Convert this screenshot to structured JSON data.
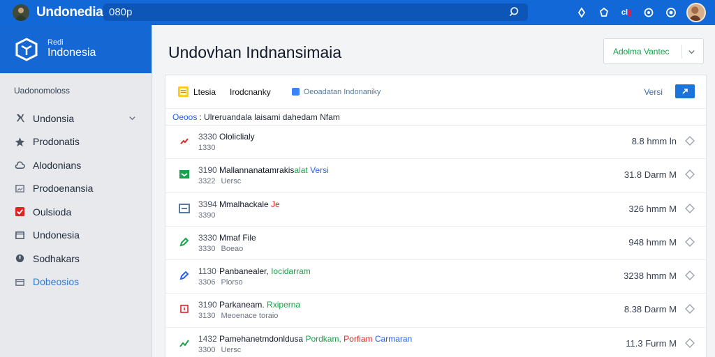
{
  "header": {
    "app_title": "Undonedia",
    "search_value": "080p",
    "icons": [
      "pin-icon",
      "tag-icon",
      "cl-badge-icon",
      "record-icon",
      "target-icon"
    ],
    "badge_text": "cl"
  },
  "sidebar": {
    "brand_sub": "Redi",
    "brand_name": "Indonesia",
    "section": "Uadonomoloss",
    "items": [
      {
        "label": "Undonsia",
        "icon": "wrench-icon",
        "has_chevron": true
      },
      {
        "label": "Prodonatis",
        "icon": "star-icon"
      },
      {
        "label": "Alodonians",
        "icon": "cloud-icon"
      },
      {
        "label": "Prodoenansia",
        "icon": "image-icon"
      },
      {
        "label": "Oulsioda",
        "icon": "check-icon"
      },
      {
        "label": "Undonesia",
        "icon": "folder-icon"
      },
      {
        "label": "Sodhakars",
        "icon": "circle-icon"
      },
      {
        "label": "Dobeosios",
        "icon": "card-icon",
        "active": true
      }
    ]
  },
  "main": {
    "title": "Undovhan Indnansimaia",
    "select_label": "Adolma Vantec",
    "panel": {
      "tab1": "Ltesia",
      "tab2": "Irodcnanky",
      "meta": "Oeoadatan Indonaniky",
      "versi": "Versi"
    },
    "filter": {
      "key": "Oeoos",
      "text": ": Ulreruandala laisami dahedam  Nfam"
    },
    "rows": [
      {
        "num": "3330",
        "name": "Ololiclialy",
        "tag": "",
        "tag2": "",
        "sub": "1330",
        "sub_text": "",
        "size": "8.8 hmm ln",
        "icon": "pen-icon",
        "color": "#dc2626"
      },
      {
        "num": "3190",
        "name": "Mallannanatamrakis",
        "tag": "alat",
        "tag2": "Versi",
        "sub": "3322",
        "sub_text": "Uersc",
        "size": "31.8 Darm M",
        "icon": "inbox-icon",
        "color": "#16a34a"
      },
      {
        "num": "3394",
        "name": "Mmalhackale",
        "tag": "",
        "tag2": "",
        "tag3": "Je",
        "sub": "3390",
        "sub_text": "",
        "size": "326 hmm M",
        "icon": "window-icon",
        "color": "#5b7a9a"
      },
      {
        "num": "3330",
        "name": "Mmaf File",
        "tag": "",
        "tag2": "",
        "sub": "3330",
        "sub_text": "Boeao",
        "size": "948 hmm M",
        "icon": "pencil-icon",
        "color": "#16a34a"
      },
      {
        "num": "1130",
        "name": "Panbanealer,",
        "tag": "Iocidarram",
        "tag2": "",
        "sub": "3306",
        "sub_text": "Plorso",
        "size": "3238 hmm M",
        "icon": "edit-icon",
        "color": "#2563eb"
      },
      {
        "num": "3190",
        "name": "Parkaneam.",
        "tag": "Rxiperna",
        "tag2": "",
        "sub": "3130",
        "sub_text": "Meoenace toraio",
        "size": "8.38 Darm M",
        "icon": "box-icon",
        "color": "#dc2626"
      },
      {
        "num": "1432",
        "name": "Pamehanetmdonldusa",
        "tag": "Pordkam,",
        "tag2": "Carmaran",
        "tag3": "Porfiam",
        "sub": "3300",
        "sub_text": "Uersc",
        "size": "11.3 Furm M",
        "icon": "trend-icon",
        "color": "#16a34a"
      }
    ]
  }
}
